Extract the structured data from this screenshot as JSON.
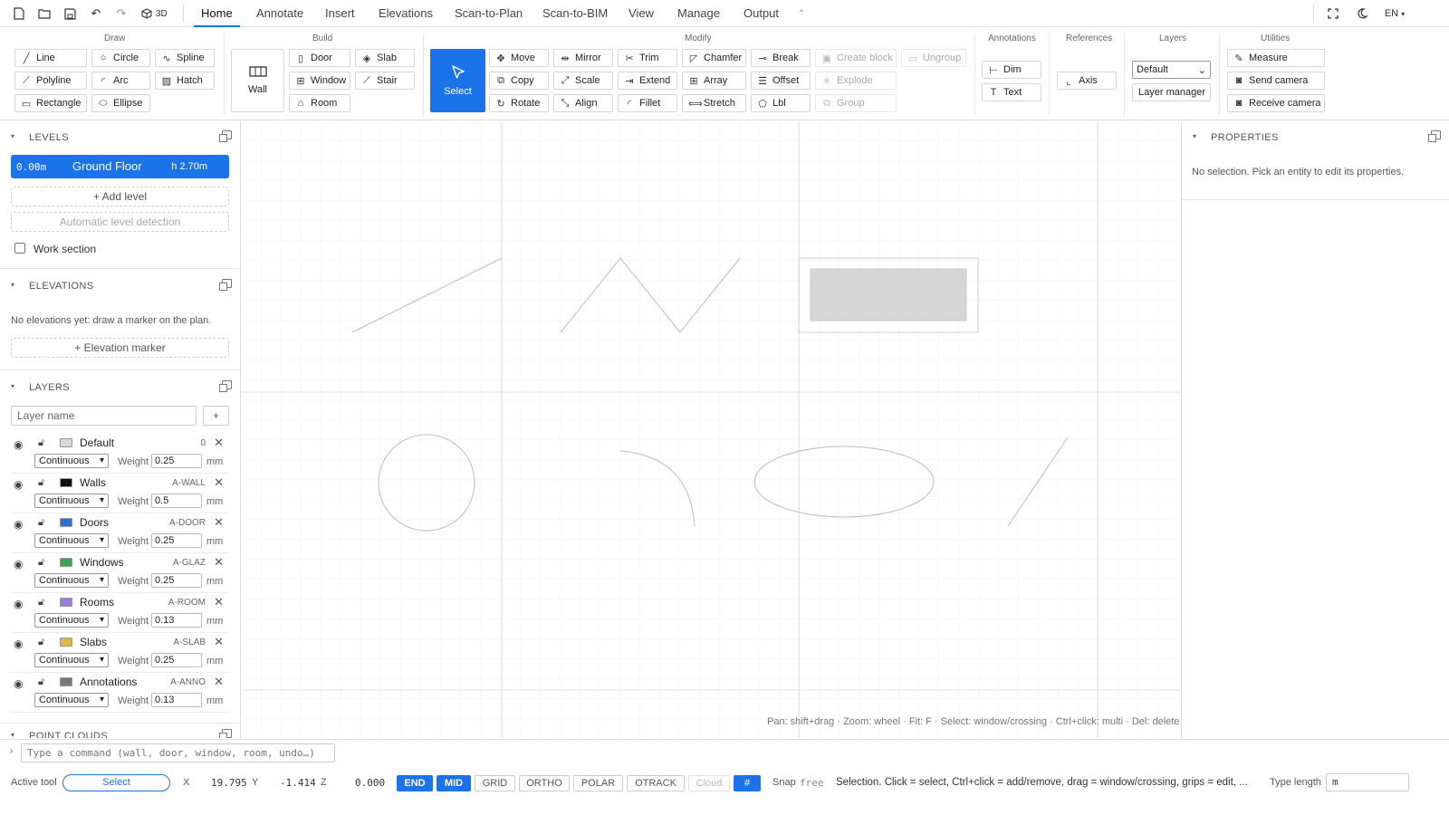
{
  "topbar": {
    "quick_icons": [
      "new-file-icon",
      "open-folder-icon",
      "save-icon",
      "undo-icon",
      "redo-icon"
    ],
    "view3d_label": "3D",
    "tabs": [
      "Home",
      "Annotate",
      "Insert",
      "Elevations",
      "Scan-to-Plan",
      "Scan-to-BIM",
      "View",
      "Manage",
      "Output"
    ],
    "active_tab": "Home",
    "lang": "EN"
  },
  "ribbon": {
    "groups": {
      "draw": "Draw",
      "build": "Build",
      "modify": "Modify",
      "annotations": "Annotations",
      "references": "References",
      "layers": "Layers",
      "utilities": "Utilities"
    },
    "draw": [
      "Line",
      "Circle",
      "Spline",
      "Polyline",
      "Arc",
      "Hatch",
      "Rectangle",
      "Ellipse"
    ],
    "wall": "Wall",
    "build": [
      "Door",
      "Slab",
      "Window",
      "Stair",
      "Room"
    ],
    "select": "Select",
    "modify": [
      "Move",
      "Mirror",
      "Trim",
      "Chamfer",
      "Break",
      "Create block",
      "Ungroup",
      "Copy",
      "Scale",
      "Extend",
      "Array",
      "Offset",
      "Explode",
      "Rotate",
      "Align",
      "Fillet",
      "Stretch",
      "Lbl",
      "Group"
    ],
    "annotations": [
      "Dim",
      "Text"
    ],
    "references": [
      "Axis"
    ],
    "layer_select": "Default",
    "layer_manager": "Layer manager",
    "utilities": [
      "Measure",
      "Send camera",
      "Receive camera"
    ]
  },
  "levels": {
    "title": "LEVELS",
    "current": {
      "elevation": "0.00m",
      "name": "Ground Floor",
      "height": "h 2.70m"
    },
    "add": "+ Add level",
    "auto": "Automatic level detection",
    "work_section": "Work section"
  },
  "elevations": {
    "title": "ELEVATIONS",
    "empty": "No elevations yet: draw a marker on the plan.",
    "add": "+ Elevation marker"
  },
  "layers": {
    "title": "LAYERS",
    "name_placeholder": "Layer name",
    "add": "+",
    "weight_label": "Weight",
    "unit": "mm",
    "items": [
      {
        "name": "Default",
        "code": "0",
        "color": "#d9d9d9",
        "linetype": "Continuous",
        "weight": "0.25"
      },
      {
        "name": "Walls",
        "code": "A-WALL",
        "color": "#111111",
        "linetype": "Continuous",
        "weight": "0.5"
      },
      {
        "name": "Doors",
        "code": "A-DOOR",
        "color": "#2f6fd6",
        "linetype": "Continuous",
        "weight": "0.25"
      },
      {
        "name": "Windows",
        "code": "A-GLAZ",
        "color": "#3aa655",
        "linetype": "Continuous",
        "weight": "0.25"
      },
      {
        "name": "Rooms",
        "code": "A-ROOM",
        "color": "#9a7be0",
        "linetype": "Continuous",
        "weight": "0.13"
      },
      {
        "name": "Slabs",
        "code": "A-SLAB",
        "color": "#e0b84a",
        "linetype": "Continuous",
        "weight": "0.25"
      },
      {
        "name": "Annotations",
        "code": "A-ANNO",
        "color": "#777777",
        "linetype": "Continuous",
        "weight": "0.13"
      }
    ]
  },
  "point_clouds": {
    "title": "POINT CLOUDS"
  },
  "canvas": {
    "hint": "Pan: shift+drag · Zoom: wheel · Fit: F · Select: window/crossing · Ctrl+click: multi · Del: delete"
  },
  "properties": {
    "title": "PROPERTIES",
    "empty": "No selection. Pick an entity to edit its properties."
  },
  "command": {
    "placeholder": "Type a command (wall, door, window, room, undo…)"
  },
  "status": {
    "active_tool_label": "Active tool",
    "active_tool": "Select",
    "x_label": "X",
    "x": "19.795",
    "y_label": "Y",
    "y": "-1.414",
    "z_label": "Z",
    "z": "0.000",
    "toggles": [
      {
        "label": "END",
        "on": true
      },
      {
        "label": "MID",
        "on": true
      },
      {
        "label": "GRID",
        "on": false
      },
      {
        "label": "ORTHO",
        "on": false
      },
      {
        "label": "POLAR",
        "on": false
      },
      {
        "label": "OTRACK",
        "on": false
      },
      {
        "label": "Cloud",
        "on": false
      }
    ],
    "snap_label": "Snap",
    "snap_value": "free",
    "message": "Selection. Click = select, Ctrl+click = add/remove, drag = window/crossing, grips = edit, ...",
    "type_length_label": "Type length",
    "type_length_value": "m"
  }
}
